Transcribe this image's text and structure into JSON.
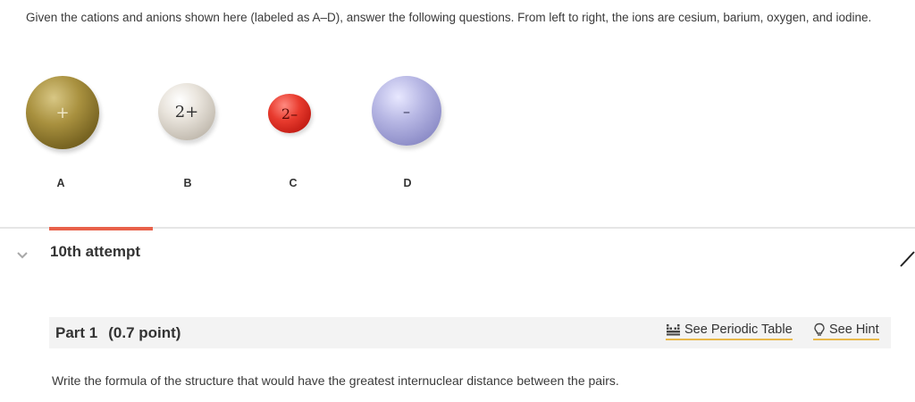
{
  "question": {
    "text": "Given the cations and anions shown here (labeled as A–D), answer the following questions. From left to right, the ions are cesium, barium, oxygen, and iodine."
  },
  "ions": [
    {
      "label": "A",
      "charge": "+",
      "color": "#a9913f"
    },
    {
      "label": "B",
      "charge": "2+",
      "color": "#e9e4dc"
    },
    {
      "label": "C",
      "charge": "2–",
      "color": "#e83b2e"
    },
    {
      "label": "D",
      "charge": "–",
      "color": "#b7b7e4"
    }
  ],
  "attempt": {
    "label": "10th attempt",
    "accent_color": "#e8614a"
  },
  "part": {
    "title": "Part 1",
    "points": "(0.7 point)",
    "periodic_label": "See Periodic Table",
    "hint_label": "See Hint",
    "prompt": "Write the formula of the structure that would have the greatest internuclear distance between the pairs."
  },
  "icons": {
    "chevron": "chevron-down-icon",
    "periodic": "periodic-table-icon",
    "hint": "lightbulb-icon",
    "corner": "arrow-icon"
  }
}
